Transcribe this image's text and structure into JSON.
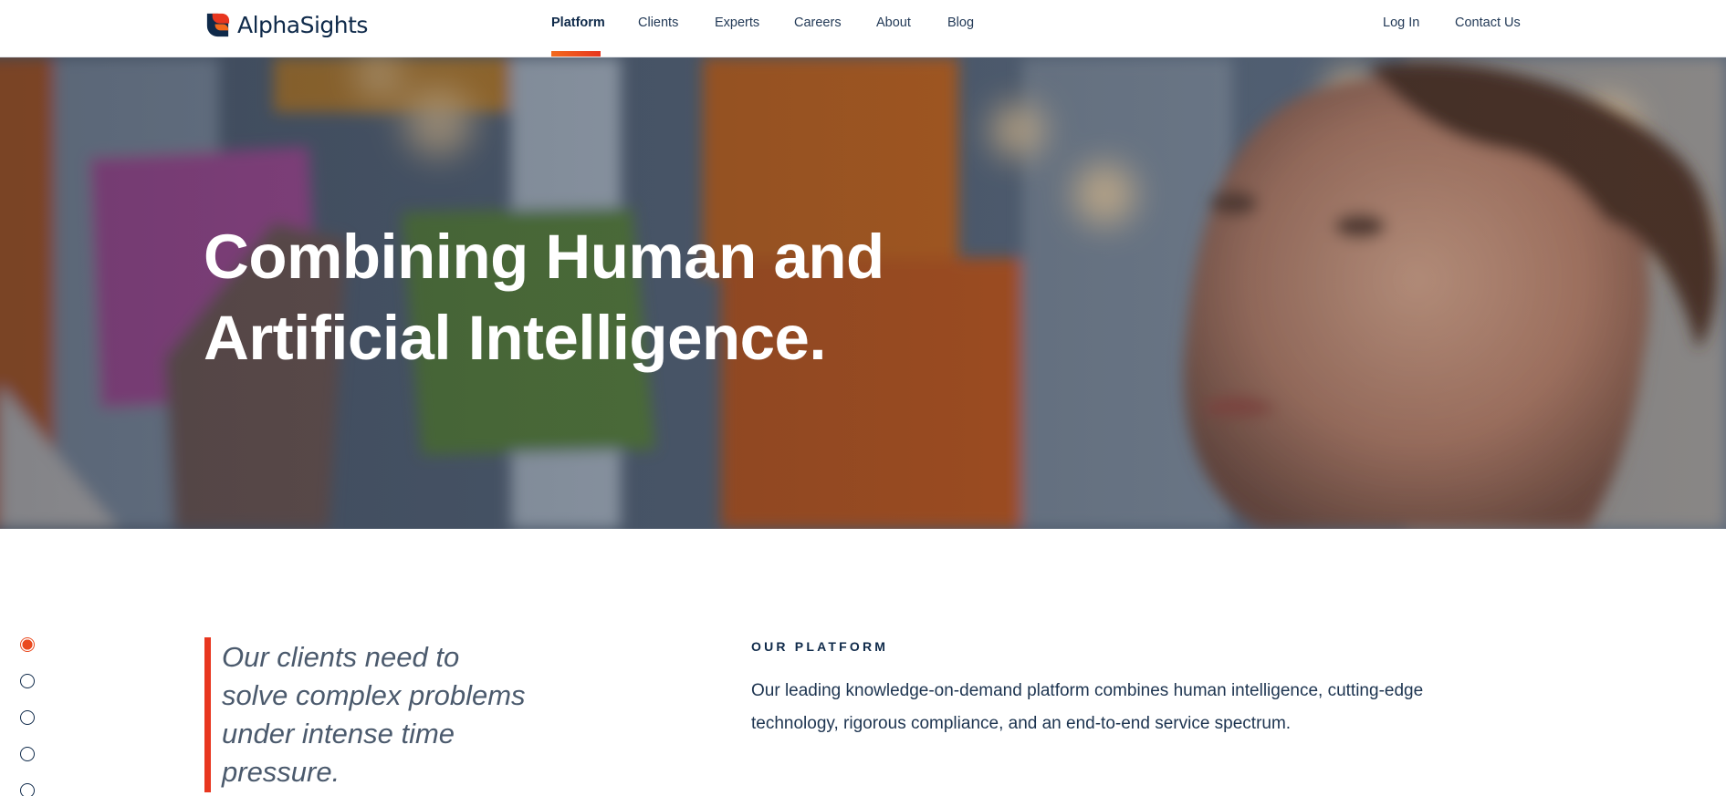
{
  "header": {
    "logo_text": "AlphaSights",
    "nav": {
      "platform": "Platform",
      "clients": "Clients",
      "experts": "Experts",
      "careers": "Careers",
      "about": "About",
      "blog": "Blog"
    },
    "login": "Log In",
    "contact": "Contact Us",
    "active_item": "Platform"
  },
  "hero": {
    "title_line1": "Combining Human and",
    "title_line2": "Artificial Intelligence."
  },
  "pager": {
    "count": 5,
    "active_index": 0
  },
  "intro": {
    "quote_lines": [
      "Our clients need to",
      "solve complex problems",
      "under intense time",
      "pressure."
    ],
    "eyebrow": "OUR PLATFORM",
    "body_lines": [
      "Our leading knowledge-on-demand platform combines human intelligence, cutting-edge",
      "technology, rigorous compliance, and an end-to-end service spectrum."
    ]
  },
  "colors": {
    "brand_navy": "#0f2a4a",
    "brand_orange": "#f36a1d",
    "brand_red": "#e8361f"
  },
  "icons": {
    "logo": "alphasights-logo-icon"
  }
}
